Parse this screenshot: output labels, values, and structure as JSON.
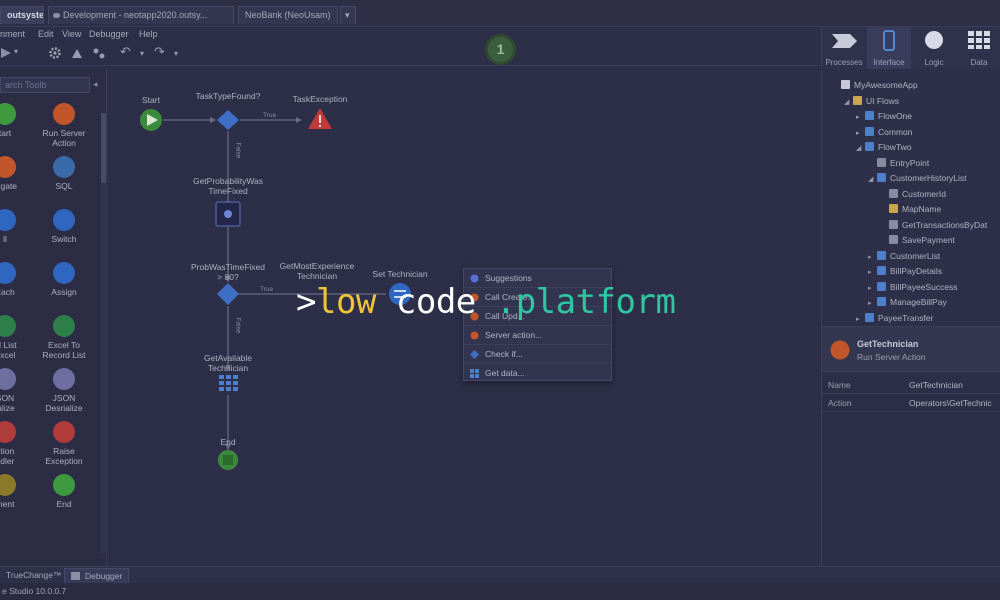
{
  "titlebar": {
    "brand_tab": "outsystems",
    "dev_tab": "Development - neotapp2020.outsy...",
    "neo_tab": "NeoBank (NeoUsam)",
    "drop_glyph": "▾"
  },
  "menu": {
    "items": [
      "nment",
      "Edit",
      "View",
      "Debugger",
      "Help"
    ]
  },
  "step_badge": "1",
  "right_tabs": [
    "Processes",
    "Interface",
    "Logic",
    "Data"
  ],
  "toolbox": {
    "search_placeholder": "arch Toolb",
    "collapse_glyph": "◂",
    "tools": [
      {
        "label": "tart",
        "color": "#3f9a3f"
      },
      {
        "label": "Run Server\nAction",
        "color": "#c2552a"
      },
      {
        "label": "regate",
        "color": "#c2552a"
      },
      {
        "label": "SQL",
        "color": "#3b6aa8"
      },
      {
        "label": "ll",
        "color": "#2f67c0"
      },
      {
        "label": "Switch",
        "color": "#2f67c0"
      },
      {
        "label": "Each",
        "color": "#2f67c0"
      },
      {
        "label": "Assign",
        "color": "#2f67c0"
      },
      {
        "label": "rd List\nExcel",
        "color": "#2f7f4a"
      },
      {
        "label": "Excel To\nRecord List",
        "color": "#2f7f4a"
      },
      {
        "label": "SON\nialize",
        "color": "#6e6fa0"
      },
      {
        "label": "JSON\nDesrialize",
        "color": "#6e6fa0"
      },
      {
        "label": "ption\nndler",
        "color": "#b03b3b"
      },
      {
        "label": "Raise\nException",
        "color": "#b03b3b"
      },
      {
        "label": "ment",
        "color": "#8a7a2a"
      },
      {
        "label": "End",
        "color": "#3f9a3f"
      }
    ]
  },
  "flow": {
    "start": "Start",
    "task_type_found": "TaskTypeFound?",
    "task_exception": "TaskException",
    "edge_true": "True",
    "edge_false": "False",
    "get_probability": "GetProbabilityWas\nTimeFixed",
    "prob_was_time_fixed": "ProbWasTimeFixed\n> 80?",
    "get_most_experience": "GetMostExperience\nTechnician",
    "set_technician": "Set Technician",
    "get_available": "GetAvailable\nTechnician",
    "end": "End"
  },
  "suggestions_menu": {
    "items": [
      "Suggestions",
      "Call Create...",
      "Call Upd...",
      "Server action...",
      "Check if...",
      "Get data..."
    ]
  },
  "tree": {
    "rows": [
      {
        "label": "MyAwesomeApp",
        "level": 0,
        "arrow": "",
        "icon": "#c8c9d8"
      },
      {
        "label": "UI Flows",
        "level": 1,
        "arrow": "◢",
        "icon": "#c8a94a"
      },
      {
        "label": "FlowOne",
        "level": 2,
        "arrow": "▸",
        "icon": "#4f7fc9"
      },
      {
        "label": "Common",
        "level": 2,
        "arrow": "▸",
        "icon": "#4f7fc9"
      },
      {
        "label": "FlowTwo",
        "level": 2,
        "arrow": "◢",
        "icon": "#4f7fc9"
      },
      {
        "label": "EntryPoint",
        "level": 3,
        "arrow": "",
        "icon": "#8a8ba2"
      },
      {
        "label": "CustomerHistoryList",
        "level": 3,
        "arrow": "◢",
        "icon": "#4f7fc9"
      },
      {
        "label": "CustomerId",
        "level": 4,
        "arrow": "",
        "icon": "#8a8ba2"
      },
      {
        "label": "MapName",
        "level": 4,
        "arrow": "",
        "icon": "#c8a94a"
      },
      {
        "label": "GetTransactionsByDat",
        "level": 4,
        "arrow": "",
        "icon": "#8a8ba2"
      },
      {
        "label": "SavePayment",
        "level": 4,
        "arrow": "",
        "icon": "#8a8ba2"
      },
      {
        "label": "CustomerList",
        "level": 3,
        "arrow": "▸",
        "icon": "#4f7fc9"
      },
      {
        "label": "BillPayDetails",
        "level": 3,
        "arrow": "▸",
        "icon": "#4f7fc9"
      },
      {
        "label": "BillPayeeSuccess",
        "level": 3,
        "arrow": "▸",
        "icon": "#4f7fc9"
      },
      {
        "label": "ManageBillPay",
        "level": 3,
        "arrow": "▸",
        "icon": "#4f7fc9"
      },
      {
        "label": "PayeeTransfer",
        "level": 2,
        "arrow": "▸",
        "icon": "#4f7fc9"
      }
    ]
  },
  "properties": {
    "title": "GetTechnician",
    "subtitle": "Run Server Action",
    "rows": [
      {
        "key": "Name",
        "value": "GetTechnician"
      },
      {
        "key": "Action",
        "value": "Operators\\GetTechnic"
      }
    ]
  },
  "bottom_tabs": [
    "TrueChange™",
    "Debugger"
  ],
  "status": "e Studio 10.0.0.7",
  "overlay": {
    "chevron": ">",
    "low": "low",
    "code": " code ",
    "platform": ".platform"
  },
  "colors": {
    "accent_yellow": "#f0c33a",
    "accent_green": "#2fc6a2",
    "background": "#2d2e47"
  }
}
